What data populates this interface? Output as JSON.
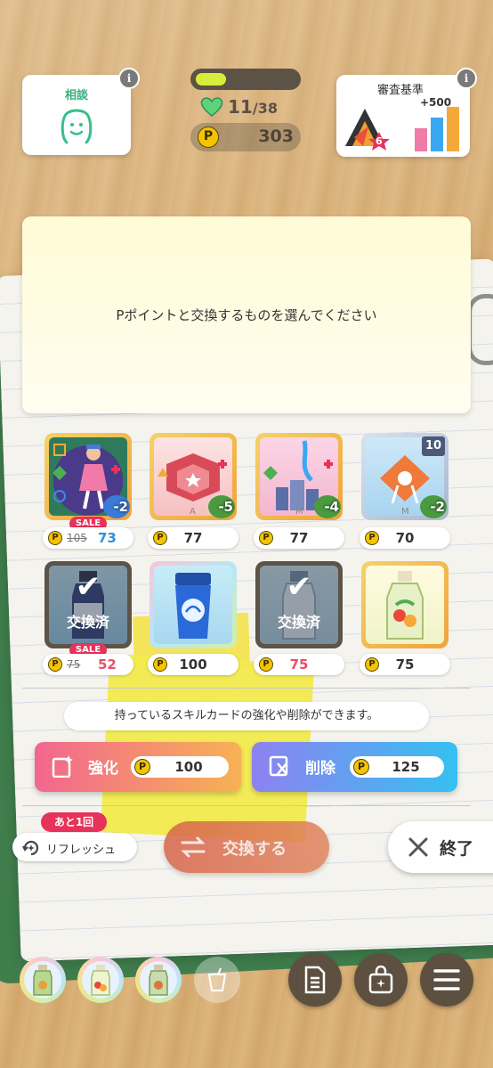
{
  "hud": {
    "consult_label": "相談",
    "info_glyph": "i",
    "stamina": {
      "current": "11",
      "separator": "/",
      "max": "38",
      "fill_fraction": 0.3
    },
    "p_points": "303",
    "p_symbol": "P",
    "criteria_label": "審査基準",
    "criteria_bonus": "+500",
    "criteria_rank": "6"
  },
  "message": "Pポイントと交換するものを選んでください",
  "sale_label": "SALE",
  "exchanged_label": "交換済",
  "items_row1": [
    {
      "name": "skill-card-idol",
      "original_price": "105",
      "price": "73",
      "on_sale": true,
      "badge": "-2"
    },
    {
      "name": "skill-card-stage",
      "price": "77",
      "badge": "-5",
      "letter": "A"
    },
    {
      "name": "skill-card-city",
      "price": "77",
      "badge": "-4",
      "letter": "M"
    },
    {
      "name": "skill-card-ribbon",
      "price": "70",
      "badge": "-2",
      "letter": "M",
      "level": "10"
    }
  ],
  "items_row2": [
    {
      "name": "drink-bottle-blue",
      "original_price": "75",
      "price": "52",
      "on_sale": true,
      "exchanged": true
    },
    {
      "name": "drink-shaker",
      "price": "100"
    },
    {
      "name": "drink-bottle-clear",
      "price": "75",
      "exchanged": true
    },
    {
      "name": "drink-juice",
      "price": "75"
    }
  ],
  "notice": "持っているスキルカードの強化や削除ができます。",
  "actions": {
    "enhance": {
      "label": "強化",
      "cost": "100"
    },
    "delete": {
      "label": "削除",
      "cost": "125"
    }
  },
  "refresh": {
    "remaining": "あと1回",
    "label": "リフレッシュ"
  },
  "exchange_button": "交換する",
  "close_button": "終了",
  "colors": {
    "accent_pink": "#e7325a",
    "enhance_gradient": [
      "#f2668f",
      "#f7b254"
    ],
    "delete_gradient": [
      "#8d82f0",
      "#35c0f0"
    ],
    "coin": "#f5c400"
  }
}
